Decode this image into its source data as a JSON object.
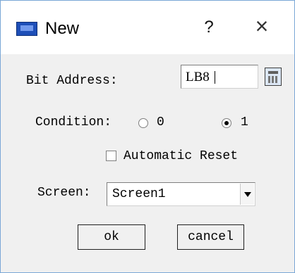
{
  "window": {
    "title": "New",
    "help_label": "?",
    "close_label": "×"
  },
  "form": {
    "bit_address_label": "Bit Address:",
    "bit_address_value": "LB8",
    "condition_label": "Condition:",
    "condition_options": [
      "0",
      "1"
    ],
    "condition_selected": "1",
    "automatic_reset_label": "Automatic Reset",
    "automatic_reset_checked": false,
    "screen_label": "Screen:",
    "screen_value": "Screen1"
  },
  "buttons": {
    "ok_label": "ok",
    "cancel_label": "cancel"
  },
  "icons": {
    "app": "app-window-icon",
    "calculator": "calculator-icon",
    "dropdown": "chevron-down-icon"
  }
}
